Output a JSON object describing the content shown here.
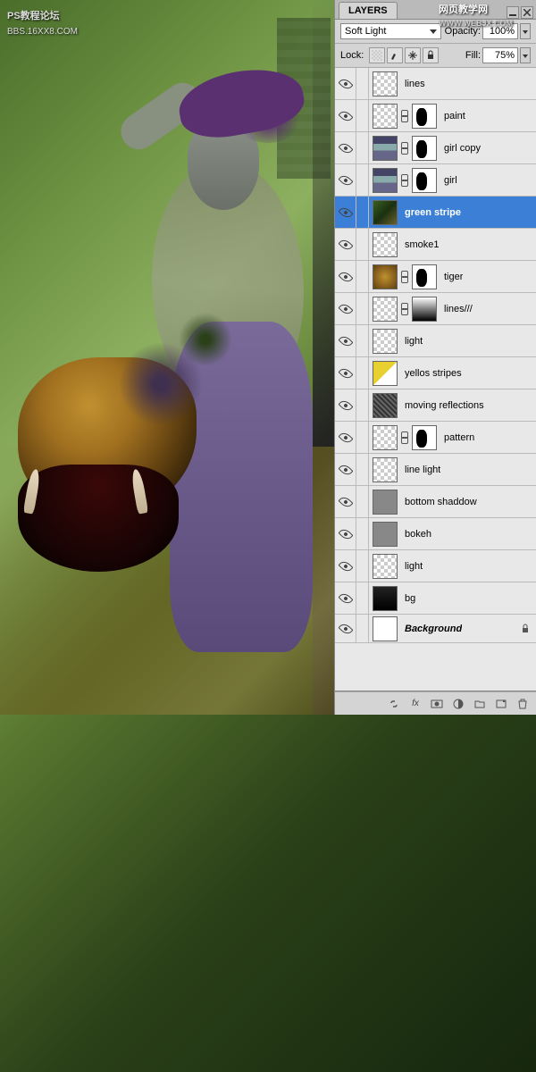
{
  "watermarks": {
    "tl_main": "PS教程论坛",
    "tl_sub": "BBS.16XX8.COM",
    "tr_main": "网页教学网",
    "tr_sub": "WWW.WEBJX.COM"
  },
  "panel": {
    "tab": "LAYERS",
    "blend_mode": "Soft Light",
    "opacity_label": "Opacity:",
    "opacity_value": "100%",
    "lock_label": "Lock:",
    "fill_label": "Fill:",
    "fill_value": "75%"
  },
  "layers": [
    {
      "name": "lines",
      "thumb": "checker",
      "mask": null,
      "selected": false
    },
    {
      "name": "paint",
      "thumb": "checker",
      "mask": "mask",
      "selected": false
    },
    {
      "name": "girl copy",
      "thumb": "girl-t",
      "mask": "mask",
      "selected": false
    },
    {
      "name": "girl",
      "thumb": "girl-t",
      "mask": "mask",
      "selected": false
    },
    {
      "name": "green stripe",
      "thumb": "green-t",
      "mask": null,
      "selected": true
    },
    {
      "name": "smoke1",
      "thumb": "checker",
      "mask": null,
      "selected": false
    },
    {
      "name": "tiger",
      "thumb": "tiger-t",
      "mask": "mask",
      "selected": false
    },
    {
      "name": "lines///",
      "thumb": "checker",
      "mask": "grad",
      "selected": false
    },
    {
      "name": "light",
      "thumb": "checker",
      "mask": null,
      "selected": false
    },
    {
      "name": "yellos stripes",
      "thumb": "yel",
      "mask": null,
      "selected": false
    },
    {
      "name": "moving reflections",
      "thumb": "patt",
      "mask": null,
      "selected": false
    },
    {
      "name": "pattern",
      "thumb": "checker",
      "mask": "mask",
      "selected": false
    },
    {
      "name": "line light",
      "thumb": "checker",
      "mask": null,
      "selected": false
    },
    {
      "name": "bottom shaddow",
      "thumb": "gray",
      "mask": null,
      "selected": false
    },
    {
      "name": "bokeh",
      "thumb": "gray",
      "mask": null,
      "selected": false
    },
    {
      "name": "light",
      "thumb": "checker",
      "mask": null,
      "selected": false
    },
    {
      "name": "bg",
      "thumb": "dark",
      "mask": null,
      "selected": false
    }
  ],
  "background_layer": {
    "name": "Background"
  }
}
